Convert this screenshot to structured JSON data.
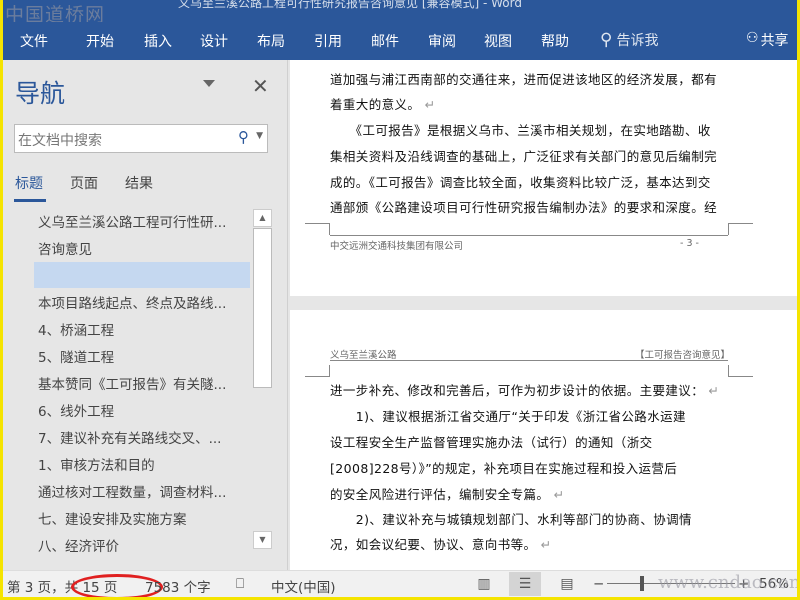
{
  "watermarks": {
    "top_left": "中国道桥网",
    "bottom_right": "www.cndao.com"
  },
  "titlebar": {
    "title": "义乌至兰溪公路工程可行性研究报告咨询意见 [兼容模式] - Word"
  },
  "ribbon": {
    "tabs": [
      "文件",
      "开始",
      "插入",
      "设计",
      "布局",
      "引用",
      "邮件",
      "审阅",
      "视图",
      "帮助"
    ],
    "tell_me": "告诉我",
    "share": "共享"
  },
  "nav": {
    "title": "导航",
    "search_placeholder": "在文档中搜索",
    "tabs": [
      "标题",
      "页面",
      "结果"
    ],
    "headings": [
      "义乌至兰溪公路工程可行性研...",
      "咨询意见",
      "",
      "本项目路线起点、终点及路线...",
      "4、桥涵工程",
      "5、隧道工程",
      "基本赞同《工可报告》有关隧...",
      "6、线外工程",
      "7、建议补充有关路线交叉、...",
      "1、审核方法和目的",
      "通过核对工程数量，调查材料...",
      "七、建设安排及实施方案",
      "八、经济评价"
    ]
  },
  "document": {
    "page1_lines": [
      "道加强与浦江西南部的交通往来，进而促进该地区的经济发展，都有",
      "着重大的意义。",
      "　　《工可报告》是根据义乌市、兰溪市相关规划，在实地踏勘、收",
      "集相关资料及沿线调查的基础上，广泛征求有关部门的意见后编制完",
      "成的。《工可报告》调查比较全面，收集资料比较广泛，基本达到交",
      "通部颁《公路建设项目可行性研究报告编制办法》的要求和深度。经"
    ],
    "page1_footer_left": "中交远洲交通科技集团有限公司",
    "page1_footer_right": "- 3 -",
    "page2_header_left": "义乌至兰溪公路",
    "page2_header_right": "【工可报告咨询意见】",
    "page2_lines": [
      "进一步补充、修改和完善后，可作为初步设计的依据。主要建议：",
      "　　1)、建议根据浙江省交通厅“关于印发《浙江省公路水运建",
      "设工程安全生产监督管理实施办法（试行）的通知（浙交",
      "[2008]228号）》”的规定，补充项目在实施过程和投入运营后",
      "的安全风险进行评估，编制安全专篇。",
      "　　2)、建议补充与城镇规划部门、水利等部门的协商、协调情",
      "况，如会议纪要、协议、意向书等。"
    ],
    "paragraph_mark": "↵"
  },
  "status": {
    "page": "第 3 页，共 15 页",
    "words": "7583 个字",
    "language": "中文(中国)",
    "zoom": "56%",
    "zoom_percent": 56
  },
  "colors": {
    "brand": "#2b579a",
    "highlight_circle": "#e02020",
    "border": "#f5e400"
  }
}
